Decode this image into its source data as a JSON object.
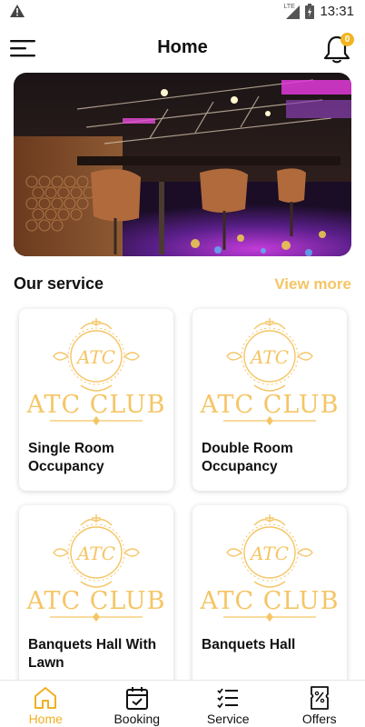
{
  "status": {
    "time": "13:31",
    "network": "LTE"
  },
  "header": {
    "title": "Home",
    "notification_count": "0"
  },
  "services": {
    "title": "Our service",
    "view_more": "View more",
    "logo_text": "ATC CLUB",
    "logo_monogram": "ATC",
    "items": [
      {
        "label": "Single Room Occupancy"
      },
      {
        "label": "Double Room Occupancy"
      },
      {
        "label": "Banquets Hall With Lawn"
      },
      {
        "label": "Banquets Hall"
      }
    ]
  },
  "nav": {
    "items": [
      {
        "label": "Home",
        "icon": "home-icon",
        "active": true
      },
      {
        "label": "Booking",
        "icon": "calendar-check-icon",
        "active": false
      },
      {
        "label": "Service",
        "icon": "checklist-icon",
        "active": false
      },
      {
        "label": "Offers",
        "icon": "ticket-percent-icon",
        "active": false
      }
    ]
  },
  "colors": {
    "accent": "#f5c565",
    "nav_active": "#f0b023",
    "badge": "#f1b522"
  }
}
